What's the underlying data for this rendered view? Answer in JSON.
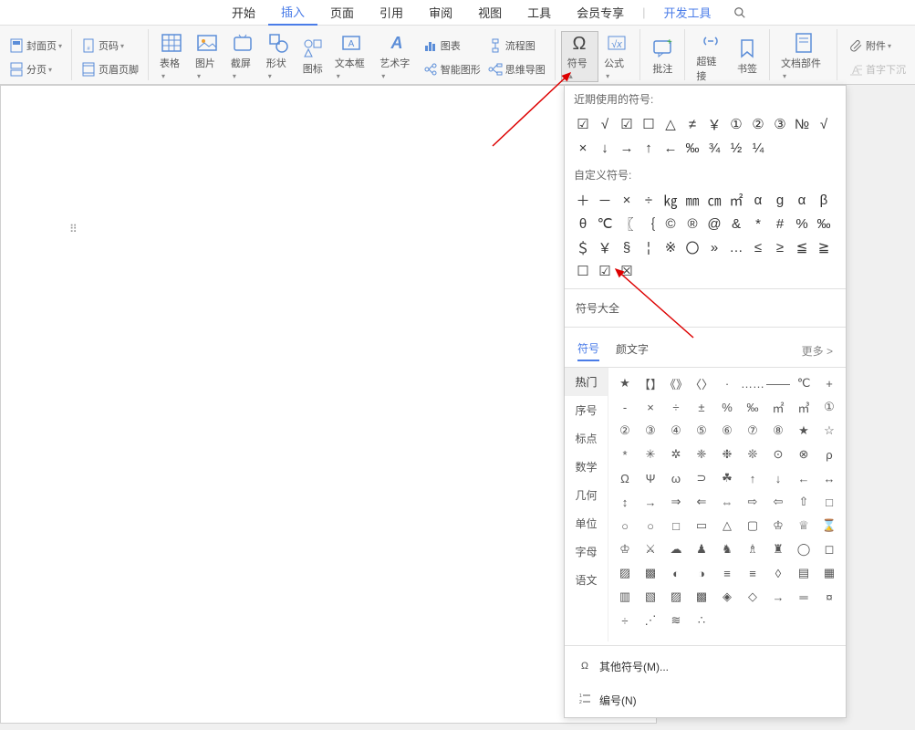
{
  "menu": {
    "start": "开始",
    "insert": "插入",
    "page": "页面",
    "reference": "引用",
    "review": "审阅",
    "view": "视图",
    "tools": "工具",
    "member": "会员专享",
    "dev": "开发工具"
  },
  "ribbon": {
    "cover": "封面页",
    "pagenumber": "页码",
    "pagebreak": "分页",
    "headerfooter": "页眉页脚",
    "table": "表格",
    "image": "图片",
    "screenshot": "截屏",
    "shape": "形状",
    "iconlib": "图标",
    "textbox": "文本框",
    "wordart": "艺术字",
    "chart_small": "图表",
    "flowchart_small": "流程图",
    "smartart": "智能图形",
    "mindmap": "思维导图",
    "symbol": "符号",
    "formula": "公式",
    "comment": "批注",
    "hyperlink": "超链接",
    "bookmark": "书签",
    "docparts": "文档部件",
    "attachment": "附件",
    "dropcap": "首字下沉"
  },
  "popup": {
    "recent_title": "近期使用的符号:",
    "recent_symbols": [
      "☑",
      "√",
      "☑",
      "☐",
      "△",
      "≠",
      "￥",
      "①",
      "②",
      "③",
      "№",
      "√",
      "×",
      "↓",
      "→",
      "↑",
      "←",
      "‰",
      "¾",
      "½",
      "¼"
    ],
    "custom_title": "自定义符号:",
    "custom_symbols": [
      "＋",
      "－",
      "×",
      "÷",
      "㎏",
      "㎜",
      "㎝",
      "㎡",
      "α",
      "g",
      "α",
      "β",
      "θ",
      "℃",
      "〖",
      "｛",
      "©",
      "®",
      "@",
      "&",
      "*",
      "#",
      "%",
      "‰",
      "＄",
      "￥",
      "§",
      "¦",
      "※",
      "〇",
      "»",
      "…",
      "≤",
      "≥",
      "≦",
      "≧",
      "☐",
      "☑",
      "☒"
    ],
    "all_title": "符号大全",
    "tab_symbol": "符号",
    "tab_emoji": "颜文字",
    "more_label": "更多",
    "categories": [
      "热门",
      "序号",
      "标点",
      "数学",
      "几何",
      "单位",
      "字母",
      "语文"
    ],
    "grid_symbols": [
      "★",
      "【】",
      "《》",
      "〈〉",
      "·",
      "……",
      "——",
      "℃",
      "+",
      "-",
      "×",
      "÷",
      "±",
      "%",
      "‰",
      "㎡",
      "㎥",
      "①",
      "②",
      "③",
      "④",
      "⑤",
      "⑥",
      "⑦",
      "⑧",
      "★",
      "☆",
      "*",
      "✳",
      "✲",
      "❈",
      "❉",
      "❊",
      "⊙",
      "⊗",
      "ρ",
      "Ω",
      "Ψ",
      "ω",
      "⊃",
      "☘",
      "↑",
      "↓",
      "←",
      "↔",
      "↕",
      "→",
      "⇒",
      "⇐",
      "⇔",
      "⇨",
      "⇦",
      "⇧",
      "□",
      "○",
      "○",
      "□",
      "▭",
      "△",
      "▢",
      "♔",
      "♕",
      "⌛",
      "♔",
      "⚔",
      "☁",
      "♟",
      "♞",
      "♗",
      "♜",
      "◯",
      "◻",
      "▨",
      "▩",
      "◐",
      "◑",
      "≡",
      "≡",
      "◊",
      "▤",
      "▦",
      "▥",
      "▧",
      "▨",
      "▩",
      "◈",
      "◇",
      "→",
      "═",
      "¤",
      "÷",
      "⋰",
      "≋",
      "∴"
    ],
    "other_symbols": "其他符号(M)...",
    "numbering": "编号(N)"
  }
}
